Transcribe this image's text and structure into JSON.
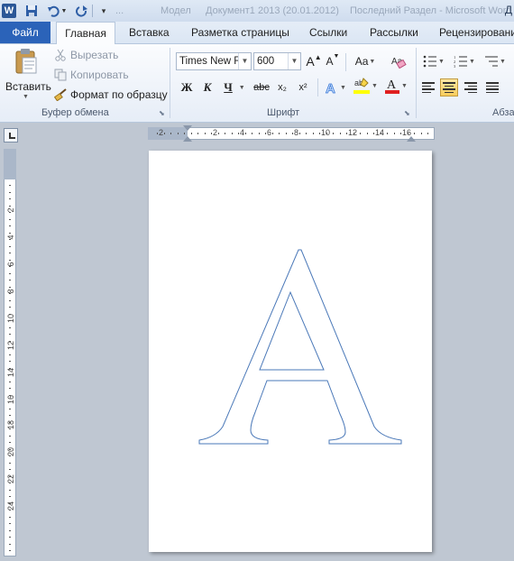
{
  "title_bar": {
    "app_icon": "word-icon",
    "faded_items": [
      "...",
      "Модел",
      "Документ1 2013 (20.01.2012)",
      "Последний Раздел - Microsoft Word"
    ],
    "title_right": "Д"
  },
  "tabs": [
    "Файл",
    "Главная",
    "Вставка",
    "Разметка страницы",
    "Ссылки",
    "Рассылки",
    "Рецензировани"
  ],
  "clipboard": {
    "paste_label": "Вставить",
    "cut_label": "Вырезать",
    "copy_label": "Копировать",
    "format_painter_label": "Формат по образцу",
    "group_label": "Буфер обмена"
  },
  "font": {
    "font_name": "Times New Ro",
    "font_size": "600",
    "bold_glyph": "Ж",
    "italic_glyph": "К",
    "underline_glyph": "Ч",
    "strike_glyph": "abc",
    "subscript_glyph": "x₂",
    "superscript_glyph": "x²",
    "case_glyph": "Aa",
    "group_label": "Шрифт"
  },
  "paragraph": {
    "group_label": "Абза",
    "selected_alignment": "center"
  },
  "ruler": {
    "h_labels": [
      "2",
      "2",
      "4",
      "6",
      "8",
      "10",
      "12",
      "14",
      "16"
    ],
    "v_labels": [
      "2",
      "4",
      "6",
      "8",
      "10",
      "12",
      "14",
      "16",
      "18",
      "20",
      "22",
      "24"
    ]
  },
  "document": {
    "letter": "A",
    "outline_color": "#4a78b8"
  },
  "colors": {
    "file_tab": "#2b63b9",
    "highlight": "#ffff00",
    "font_color": "#e02020",
    "accent": "#2b5797"
  }
}
